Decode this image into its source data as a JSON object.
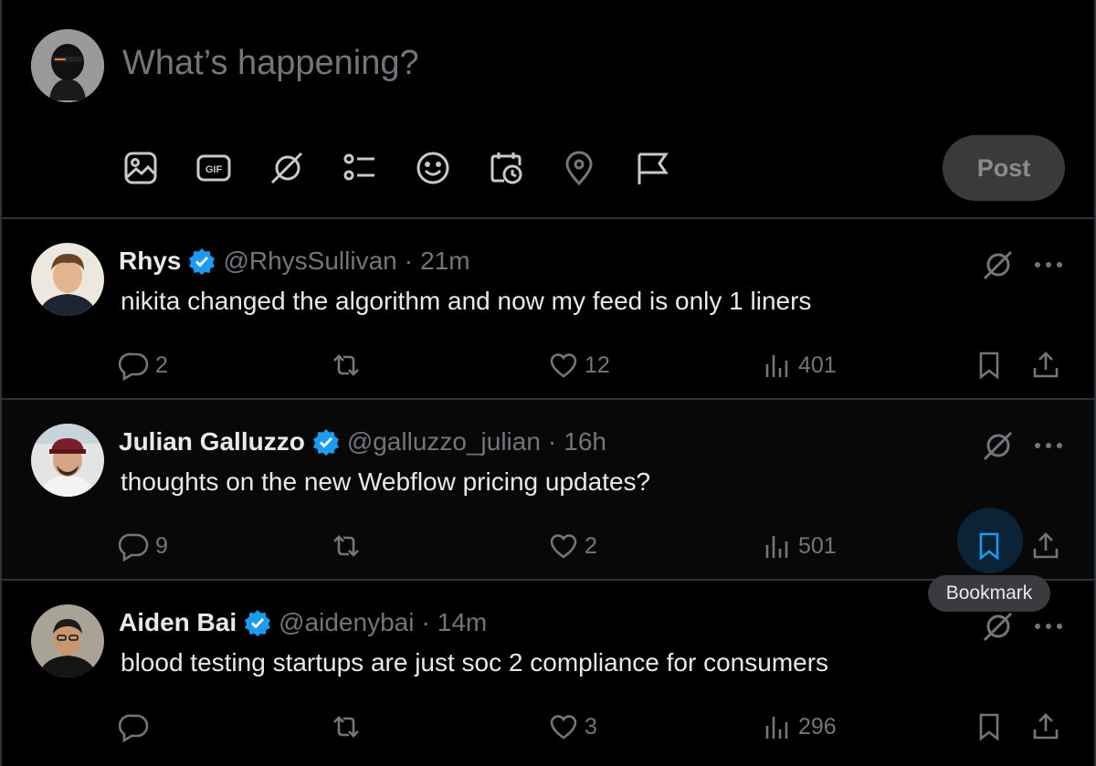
{
  "composer": {
    "placeholder": "What’s happening?",
    "post_label": "Post",
    "tools": [
      "image-icon",
      "gif-icon",
      "grok-icon",
      "poll-icon",
      "emoji-icon",
      "schedule-icon",
      "location-icon",
      "flag-icon"
    ],
    "gif_label": "GIF"
  },
  "colors": {
    "background": "#000000",
    "text": "#e7e9ea",
    "muted": "#71767b",
    "accent": "#1d9bf0",
    "border": "#2f3336"
  },
  "tweets": [
    {
      "name": "Rhys",
      "handle": "@RhysSullivan",
      "sep": "·",
      "time": "21m",
      "text": "nikita changed the algorithm and now my feed is only 1 liners",
      "replies": "2",
      "retweets": "",
      "likes": "12",
      "views": "401",
      "bookmarked": false
    },
    {
      "name": "Julian Galluzzo",
      "handle": "@galluzzo_julian",
      "sep": "·",
      "time": "16h",
      "text": "thoughts on the new Webflow pricing updates?",
      "replies": "9",
      "retweets": "",
      "likes": "2",
      "views": "501",
      "bookmarked": true
    },
    {
      "name": "Aiden Bai",
      "handle": "@aidenybai",
      "sep": "·",
      "time": "14m",
      "text": "blood testing startups are just soc 2 compliance for consumers",
      "replies": "",
      "retweets": "",
      "likes": "3",
      "views": "296",
      "bookmarked": false
    }
  ],
  "tooltip": {
    "label": "Bookmark"
  }
}
